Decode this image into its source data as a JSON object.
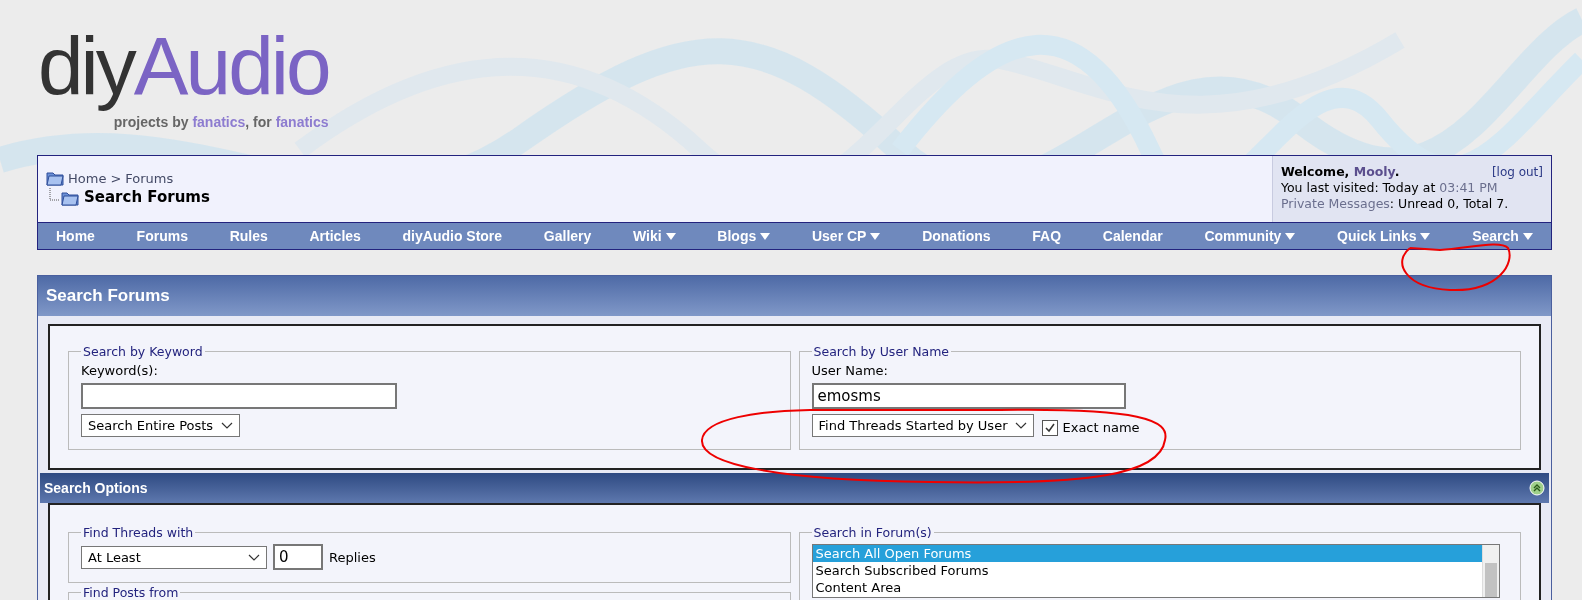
{
  "logo": {
    "name_dark": "diy",
    "name_color": "Audio",
    "tagline": "projects by **fanatics**, for **fanatics**"
  },
  "breadcrumb": {
    "links": [
      "Home",
      "Forums"
    ],
    "separator": ">",
    "current": "Search Forums"
  },
  "welcome": {
    "greeting": "Welcome,",
    "user": "Mooly",
    "period": ".",
    "logout": "[log out]",
    "last_visited": "You last visited: Today at",
    "last_visited_time": "03:41 PM",
    "pm_link": "Private Messages",
    "pm_counts": ": Unread 0, Total 7."
  },
  "nav": [
    {
      "label": "Home",
      "dropdown": false
    },
    {
      "label": "Forums",
      "dropdown": false
    },
    {
      "label": "Rules",
      "dropdown": false
    },
    {
      "label": "Articles",
      "dropdown": false
    },
    {
      "label": "diyAudio Store",
      "dropdown": false
    },
    {
      "label": "Gallery",
      "dropdown": false
    },
    {
      "label": "Wiki",
      "dropdown": true
    },
    {
      "label": "Blogs",
      "dropdown": true
    },
    {
      "label": "User CP",
      "dropdown": true
    },
    {
      "label": "Donations",
      "dropdown": false
    },
    {
      "label": "FAQ",
      "dropdown": false
    },
    {
      "label": "Calendar",
      "dropdown": false
    },
    {
      "label": "Community",
      "dropdown": true
    },
    {
      "label": "Quick Links",
      "dropdown": true
    },
    {
      "label": "Search",
      "dropdown": true
    }
  ],
  "panel_title": "Search Forums",
  "keyword_section": {
    "legend": "Search by Keyword",
    "label": "Keyword(s):",
    "select": "Search Entire Posts"
  },
  "user_section": {
    "legend": "Search by User Name",
    "label": "User Name:",
    "value": "emosms",
    "select": "Find Threads Started by User",
    "exact_name": {
      "label": "Exact name",
      "checked": true
    }
  },
  "options_title": "Search Options",
  "threads_with": {
    "legend": "Find Threads with",
    "select": "At Least",
    "count": "0",
    "suffix": "Replies"
  },
  "posts_from": {
    "legend": "Find Posts from"
  },
  "forums": {
    "legend": "Search in Forum(s)",
    "items": [
      {
        "label": "Search All Open Forums",
        "selected": true
      },
      {
        "label": "Search Subscribed Forums",
        "selected": false
      },
      {
        "label": "Content Area",
        "selected": false
      }
    ]
  }
}
